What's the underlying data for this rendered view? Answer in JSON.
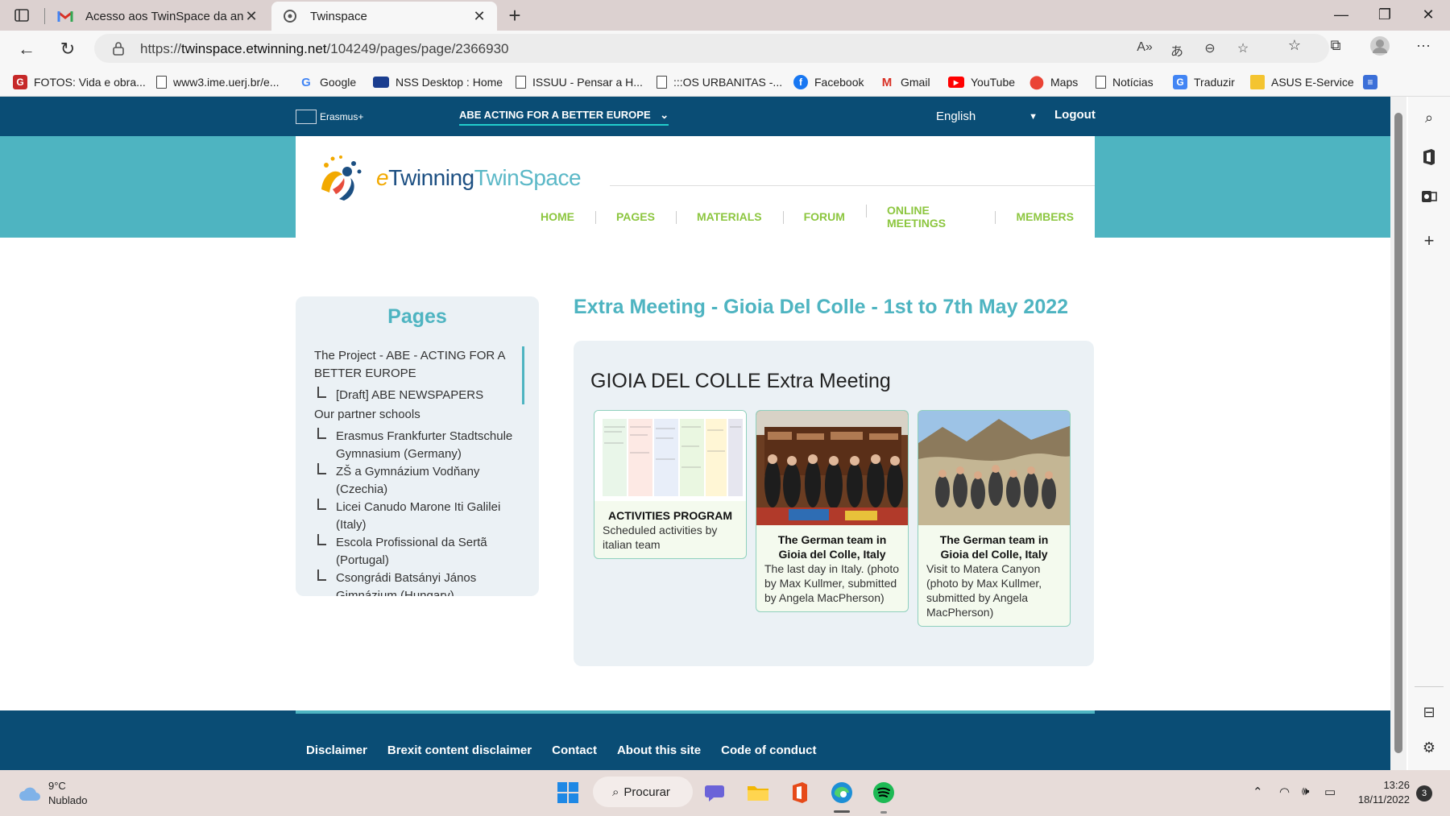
{
  "browser": {
    "tabs": [
      {
        "title": "Acesso aos TwinSpace da antiga",
        "favicon": "gmail-icon"
      },
      {
        "title": "Twinspace",
        "favicon": "etwinning-icon"
      }
    ],
    "url_prefix": "https://",
    "url_domain": "twinspace.etwinning.net",
    "url_path": "/104249/pages/page/2366930",
    "bookmarks": [
      "FOTOS: Vida e obra...",
      "www3.ime.uerj.br/e...",
      "Google",
      "NSS Desktop : Home",
      "ISSUU - Pensar a H...",
      ":::OS URBANITAS -...",
      "Facebook",
      "Gmail",
      "YouTube",
      "Maps",
      "Notícias",
      "Traduzir",
      "ASUS E-Service"
    ]
  },
  "site": {
    "erasmus_label": "Erasmus+",
    "project_menu": "ABE ACTING FOR A BETTER EUROPE",
    "language": "English",
    "logout": "Logout",
    "logo": {
      "e": "e",
      "twinning": "Twinning",
      "twinspace": "TwinSpace"
    },
    "nav": [
      "HOME",
      "PAGES",
      "MATERIALS",
      "FORUM",
      "ONLINE MEETINGS",
      "MEMBERS"
    ]
  },
  "sidebar": {
    "title": "Pages",
    "items": [
      {
        "label": "The Project - ABE - ACTING FOR A BETTER EUROPE",
        "level": 0
      },
      {
        "label": "[Draft] ABE NEWSPAPERS",
        "level": 1
      },
      {
        "label": "Our partner schools",
        "level": 0
      },
      {
        "label": "Erasmus Frankfurter Stadtschule Gymnasium (Germany)",
        "level": 1
      },
      {
        "label": "ZŠ a Gymnázium Vodňany (Czechia)",
        "level": 1
      },
      {
        "label": "Licei Canudo Marone Iti Galilei (Italy)",
        "level": 1
      },
      {
        "label": "Escola Profissional da Sertã (Portugal)",
        "level": 1
      },
      {
        "label": "Csongrádi Batsányi János Gimnázium (Hungary)",
        "level": 1
      }
    ]
  },
  "content": {
    "page_title": "Extra Meeting - Gioia Del Colle - 1st to 7th May 2022",
    "heading": "GIOIA DEL COLLE Extra Meeting",
    "tiles": [
      {
        "title": "ACTIVITIES PROGRAM",
        "text": "Scheduled activities by italian team"
      },
      {
        "title": "The German team in Gioia del Colle, Italy",
        "text": "The last day in Italy. (photo by Max Kullmer, submitted by Angela MacPherson)"
      },
      {
        "title": "The German team in Gioia del Colle, Italy",
        "text": "Visit to Matera Canyon (photo by Max Kullmer, submitted by Angela MacPherson)"
      }
    ]
  },
  "footer": {
    "links": [
      "Disclaimer",
      "Brexit content disclaimer",
      "Contact",
      "About this site",
      "Code of conduct"
    ]
  },
  "taskbar": {
    "temp": "9°C",
    "weather": "Nublado",
    "search": "Procurar",
    "time": "13:26",
    "date": "18/11/2022",
    "notifications": "3"
  },
  "colors": {
    "site_navy": "#0a4d75",
    "teal": "#4eb4c1",
    "nav_green": "#8cc63f"
  }
}
